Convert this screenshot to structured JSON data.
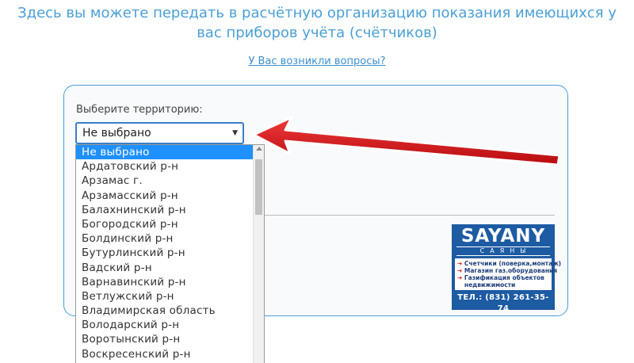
{
  "header": {
    "headline": "Здесь вы можете передать в расчётную организацию показания имеющихся у вас приборов учёта (счётчиков)",
    "help_link": "У Вас возникли вопросы?"
  },
  "form": {
    "territory_label": "Выберите территорию:",
    "territory_selected": "Не выбрано",
    "caret": "▼",
    "options": [
      "Не выбрано",
      "Ардатовский р-н",
      "Арзамас г.",
      "Арзамасский р-н",
      "Балахнинский р-н",
      "Богородский р-н",
      "Болдинский р-н",
      "Бутурлинский р-н",
      "Вадский р-н",
      "Варнавинский р-н",
      "Ветлужский р-н",
      "Владимирская область",
      "Володарский р-н",
      "Воротынский р-н",
      "Воскресенский р-н"
    ],
    "selected_index": 0
  },
  "ad": {
    "logo": "SAYANY",
    "logo_sub": "САЯНЫ",
    "services": [
      "Счетчики (поверка,монтаж)",
      "Магазин газ.оборудования",
      "Газификация объектов",
      "недвижимости"
    ],
    "phone": "ТЕЛ.: (831) 261-35-74"
  },
  "annotation": {
    "arrow_color": "#e0141c",
    "icon": "red-arrow-icon"
  },
  "colors": {
    "accent": "#4a9fd6",
    "selected_option": "#1e90ff",
    "ad_background": "#1d5ba3"
  }
}
